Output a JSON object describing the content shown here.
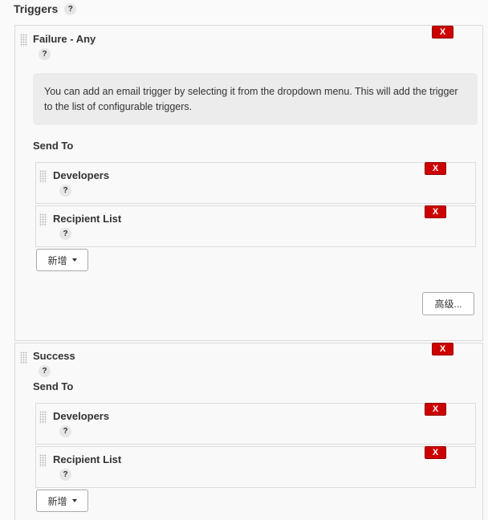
{
  "section": {
    "title": "Triggers",
    "help": "?"
  },
  "triggers": [
    {
      "name": "Failure - Any",
      "help": "?",
      "delete_label": "X",
      "info": "You can add an email trigger by selecting it from the dropdown menu. This will add the trigger to the list of configurable triggers.",
      "send_to_label": "Send To",
      "recipients": [
        {
          "name": "Developers",
          "help": "?",
          "delete_label": "X"
        },
        {
          "name": "Recipient List",
          "help": "?",
          "delete_label": "X"
        }
      ],
      "add_label": "新增",
      "advanced_label": "高级..."
    },
    {
      "name": "Success",
      "help": "?",
      "delete_label": "X",
      "send_to_label": "Send To",
      "recipients": [
        {
          "name": "Developers",
          "help": "?",
          "delete_label": "X"
        },
        {
          "name": "Recipient List",
          "help": "?",
          "delete_label": "X"
        }
      ],
      "add_label": "新增"
    }
  ]
}
